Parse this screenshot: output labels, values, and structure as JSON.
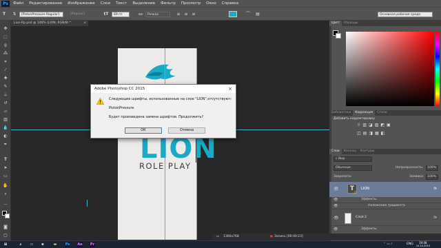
{
  "app": {
    "logo": "Ps"
  },
  "menu": [
    "Файл",
    "Редактирование",
    "Изображение",
    "Слои",
    "Текст",
    "Выделение",
    "Фильтр",
    "Просмотр",
    "Окно",
    "Справка"
  ],
  "options": {
    "tool_icon": "type-tool-icon",
    "font_family": "[PistonPressure Regular]",
    "font_style": "[Regular]",
    "size_label": "69 пт",
    "antialias": "Резкое",
    "workspace": "Основная рабочая среда"
  },
  "document": {
    "tab_title": "Lion-Rp.psd @ 146% (LION, RGB/8) *",
    "canvas_title": "LION",
    "canvas_subtitle": "ROLE PLAY",
    "accent_color": "#1aa9c6"
  },
  "status": {
    "zoom": "146,41%",
    "doc_size": "Док: 204,5К/1,18М"
  },
  "dialog": {
    "title": "Adobe Photoshop CC 2015",
    "message_line1": "Следующие шрифты, использованные на слое \"LION\",отсутствуют:",
    "font_name": "PistonPressure",
    "question": "Будет произведена замена шрифтов. Продолжить?",
    "ok_label": "ОК",
    "cancel_label": "Отмена"
  },
  "color_panel": {
    "tabs": [
      "Цвет",
      "Образцы"
    ]
  },
  "adjust_panel": {
    "tabs": [
      "Библиотеки",
      "Коррекция",
      "Стили"
    ],
    "subtitle": "Добавить корректировку"
  },
  "layers_panel": {
    "tabs": [
      "Слои",
      "Каналы",
      "Контуры"
    ],
    "filter_label": "Вид",
    "blend_mode": "Обычные",
    "opacity_label": "Непрозрачность:",
    "opacity_value": "100%",
    "lock_label": "Закрепить:",
    "fill_label": "Заливка:",
    "fill_value": "100%",
    "layers": [
      {
        "name": "LION",
        "fx": "fx",
        "effects_label": "Эффекты",
        "effect": "Наложение градиента"
      },
      {
        "name": "Слой 2",
        "fx": "fx",
        "effects_label": "Эффекты"
      }
    ]
  },
  "recording": {
    "resolution": "1366x768",
    "record_label": "Запись [00:00:23]"
  },
  "taskbar": {
    "apps": [
      "Ps",
      "Ae",
      "Pr"
    ],
    "lang": "ENG",
    "time": "19:08",
    "date": "24.10.2015"
  }
}
